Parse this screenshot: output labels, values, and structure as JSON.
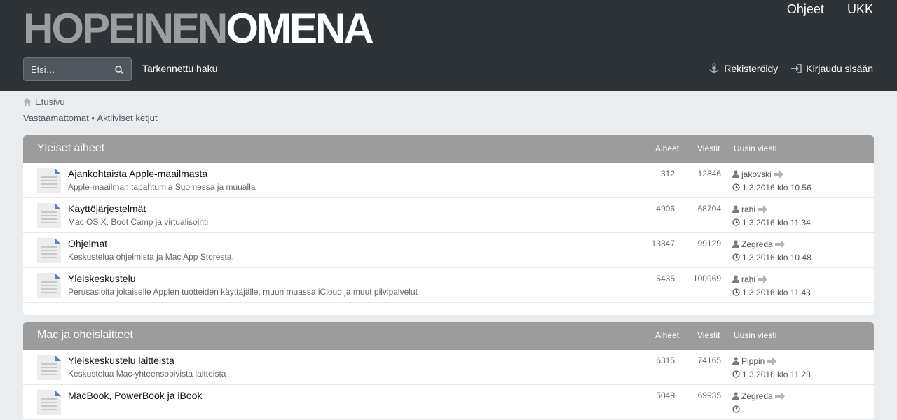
{
  "header": {
    "logo_part1": "HOPEINEN",
    "logo_part2": "OMENA",
    "top_links": [
      "Ohjeet",
      "UKK"
    ],
    "search_placeholder": "Etsi…",
    "advanced_search": "Tarkennettu haku",
    "register": "Rekisteröidy",
    "login": "Kirjaudu sisään"
  },
  "breadcrumb": {
    "home": "Etusivu",
    "unanswered": "Vastaamattomat",
    "separator": " • ",
    "active": "Aktiiviset ketjut"
  },
  "columns": {
    "topics": "Aiheet",
    "posts": "Viestit",
    "latest": "Uusin viesti"
  },
  "sections": [
    {
      "title": "Yleiset aiheet",
      "forums": [
        {
          "name": "Ajankohtaista Apple-maailmasta",
          "desc": "Apple-maailman tapahtumia Suomessa ja muualla",
          "topics": "312",
          "posts": "12846",
          "author": "jakovski",
          "date": "1.3.2016 klo 10.56"
        },
        {
          "name": "Käyttöjärjestelmät",
          "desc": "Mac OS X, Boot Camp ja virtualisointi",
          "topics": "4906",
          "posts": "68704",
          "author": "rahi",
          "date": "1.3.2016 klo 11.34"
        },
        {
          "name": "Ohjelmat",
          "desc": "Keskustelua ohjelmista ja Mac App Storesta.",
          "topics": "13347",
          "posts": "99129",
          "author": "Zegreda",
          "date": "1.3.2016 klo 10.48"
        },
        {
          "name": "Yleiskeskustelu",
          "desc": "Perusasioita jokaiselle Applen tuotteiden käyttäjälle, muun muassa iCloud ja muut pilvipalvelut",
          "topics": "5435",
          "posts": "100969",
          "author": "rahi",
          "date": "1.3.2016 klo 11.43"
        }
      ]
    },
    {
      "title": "Mac ja oheislaitteet",
      "forums": [
        {
          "name": "Yleiskeskustelu laitteista",
          "desc": "Keskustelua Mac-yhteensopivista laitteista",
          "topics": "6315",
          "posts": "74165",
          "author": "Pippin",
          "date": "1.3.2016 klo 11.28"
        },
        {
          "name": "MacBook, PowerBook ja iBook",
          "desc": "",
          "topics": "5049",
          "posts": "69935",
          "author": "Zegreda",
          "date": ""
        }
      ]
    }
  ]
}
